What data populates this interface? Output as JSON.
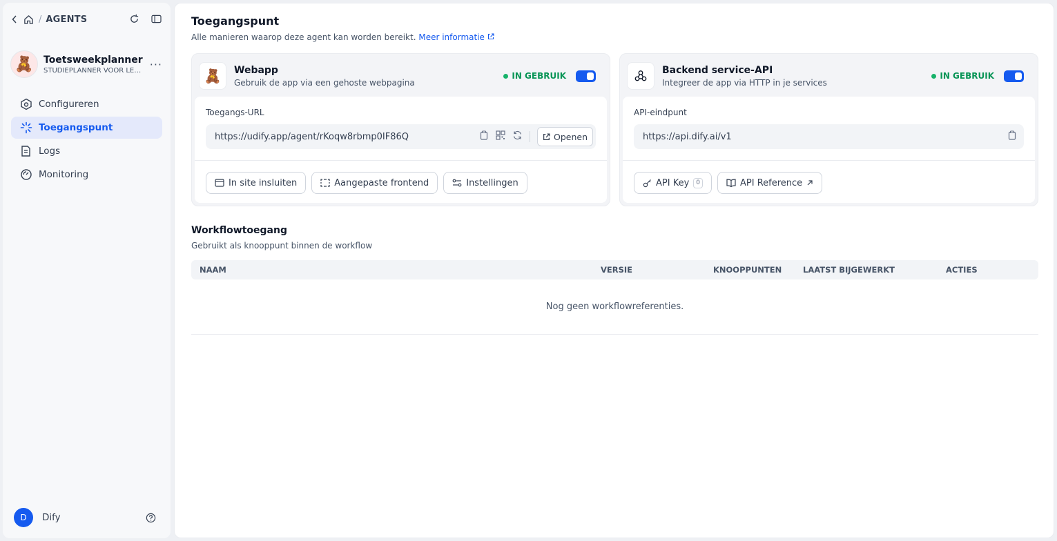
{
  "sidebar": {
    "breadcrumb": {
      "section": "AGENTS",
      "separator": "/"
    },
    "app": {
      "name": "Toetsweekplanner",
      "subtitle": "STUDIEPLANNER VOOR LEERLINGEN",
      "emoji": "🧸",
      "more": "···"
    },
    "nav": [
      {
        "label": "Configureren",
        "icon": "configure-icon"
      },
      {
        "label": "Toegangspunt",
        "icon": "access-point-icon",
        "active": true
      },
      {
        "label": "Logs",
        "icon": "logs-icon"
      },
      {
        "label": "Monitoring",
        "icon": "monitoring-icon"
      }
    ],
    "user": {
      "initial": "D",
      "name": "Dify"
    }
  },
  "main": {
    "title": "Toegangspunt",
    "subtitle": "Alle manieren waarop deze agent kan worden bereikt.",
    "more_link": "Meer informatie",
    "webapp": {
      "emoji": "🧸",
      "title": "Webapp",
      "desc": "Gebruik de app via een gehoste webpagina",
      "status": "IN GEBRUIK",
      "field_label": "Toegangs-URL",
      "url": "https://udify.app/agent/rKoqw8rbmp0IF86Q",
      "open_label": "Openen",
      "buttons": [
        "In site insluiten",
        "Aangepaste frontend",
        "Instellingen"
      ]
    },
    "api": {
      "title": "Backend service-API",
      "desc": "Integreer de app via HTTP in je services",
      "status": "IN GEBRUIK",
      "field_label": "API-eindpunt",
      "url": "https://api.dify.ai/v1",
      "key_label": "API Key",
      "key_count": "0",
      "reference_label": "API Reference"
    },
    "workflow": {
      "title": "Workflowtoegang",
      "subtitle": "Gebruikt als knooppunt binnen de workflow",
      "columns": [
        "NAAM",
        "VERSIE",
        "KNOOPPUNTEN",
        "LAATST BIJGEWERKT",
        "ACTIES"
      ],
      "empty": "Nog geen workflowreferenties."
    }
  },
  "colors": {
    "accent": "#155aef",
    "success": "#17b26a"
  }
}
